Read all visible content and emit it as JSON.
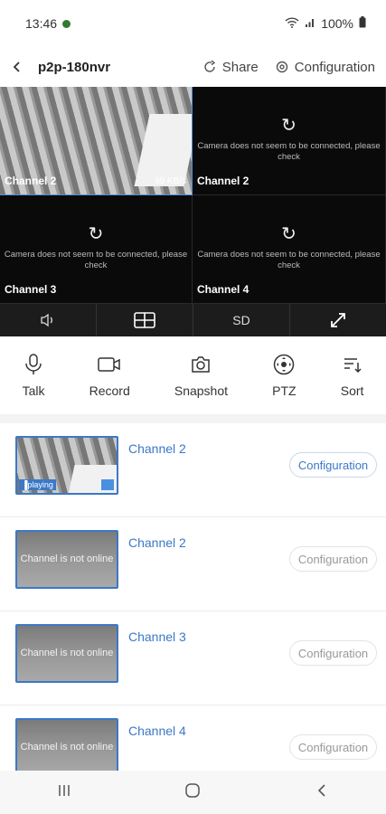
{
  "status": {
    "time": "13:46",
    "battery": "100%"
  },
  "header": {
    "title": "p2p-180nvr",
    "share": "Share",
    "configuration": "Configuration"
  },
  "grid": {
    "cells": [
      {
        "name": "Channel 2",
        "rate": "99 KB/s",
        "message": ""
      },
      {
        "name": "Channel 2",
        "message": "Camera does not seem to be connected, please check"
      },
      {
        "name": "Channel 3",
        "message": "Camera does not seem to be connected, please check"
      },
      {
        "name": "Channel 4",
        "message": "Camera does not seem to be connected, please check"
      }
    ]
  },
  "controls": {
    "quality": "SD"
  },
  "tools": [
    {
      "label": "Talk",
      "icon": "microphone-icon"
    },
    {
      "label": "Record",
      "icon": "video-camera-icon"
    },
    {
      "label": "Snapshot",
      "icon": "camera-icon"
    },
    {
      "label": "PTZ",
      "icon": "ptz-icon"
    },
    {
      "label": "Sort",
      "icon": "sort-icon"
    }
  ],
  "channels": [
    {
      "name": "Channel 2",
      "overlay": "playing",
      "config": "Configuration"
    },
    {
      "name": "Channel 2",
      "overlay": "Channel is not online",
      "config": "Configuration"
    },
    {
      "name": "Channel 3",
      "overlay": "Channel is not online",
      "config": "Configuration"
    },
    {
      "name": "Channel 4",
      "overlay": "Channel is not online",
      "config": "Configuration"
    }
  ],
  "colors": {
    "accent": "#3b78c7",
    "grid_bg": "#000000"
  }
}
